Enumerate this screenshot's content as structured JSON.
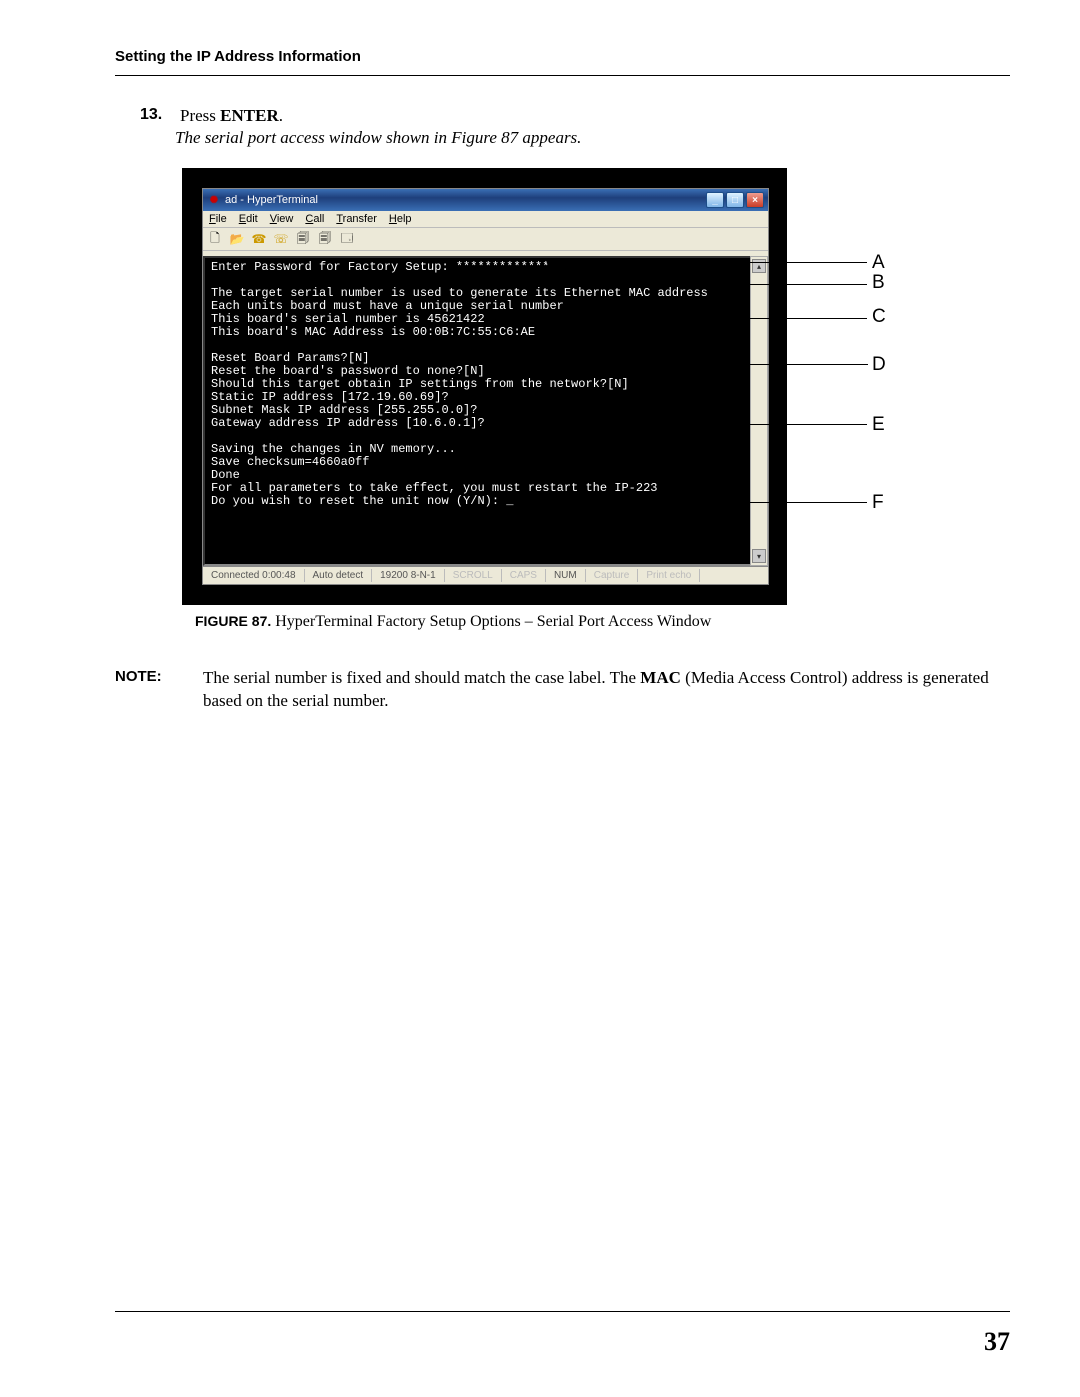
{
  "header": {
    "section": "Setting the IP Address Information"
  },
  "step": {
    "num": "13.",
    "text_pre": "Press ",
    "text_bold": "ENTER",
    "text_post": ".",
    "italic": "The serial port access window shown in Figure 87 appears."
  },
  "window": {
    "title": "ad - HyperTerminal",
    "menu": {
      "file": "File",
      "edit": "Edit",
      "view": "View",
      "call": "Call",
      "transfer": "Transfer",
      "help": "Help"
    },
    "toolbar_icons": [
      "new-file-icon",
      "open-folder-icon",
      "phone-icon",
      "hangup-icon",
      "send-icon",
      "receive-icon",
      "properties-icon"
    ],
    "terminal_lines": [
      "Enter Password for Factory Setup: *************",
      "",
      "The target serial number is used to generate its Ethernet MAC address",
      "Each units board must have a unique serial number",
      "This board's serial number is 45621422",
      "This board's MAC Address is 00:0B:7C:55:C6:AE",
      "",
      "Reset Board Params?[N]",
      "Reset the board's password to none?[N]",
      "Should this target obtain IP settings from the network?[N]",
      "Static IP address [172.19.60.69]?",
      "Subnet Mask IP address [255.255.0.0]?",
      "Gateway address IP address [10.6.0.1]?",
      "",
      "Saving the changes in NV memory...",
      "Save checksum=4660a0ff",
      "Done",
      "For all parameters to take effect, you must restart the IP-223",
      "Do you wish to reset the unit now (Y/N): _"
    ],
    "status": {
      "connected": "Connected 0:00:48",
      "detect": "Auto detect",
      "baud": "19200 8-N-1",
      "scroll": "SCROLL",
      "caps": "CAPS",
      "num": "NUM",
      "capture": "Capture",
      "print": "Print echo"
    }
  },
  "callouts": {
    "a": "A",
    "b": "B",
    "c": "C",
    "d": "D",
    "e": "E",
    "f": "F"
  },
  "figure": {
    "label": "FIGURE 87.",
    "caption": "HyperTerminal Factory Setup Options – Serial Port Access Window"
  },
  "note": {
    "label": "NOTE:",
    "text_pre": "The serial number is fixed and should match the case label. The ",
    "text_bold": "MAC",
    "text_post": " (Media Access Control) address is generated based on the serial number."
  },
  "page_number": "37"
}
